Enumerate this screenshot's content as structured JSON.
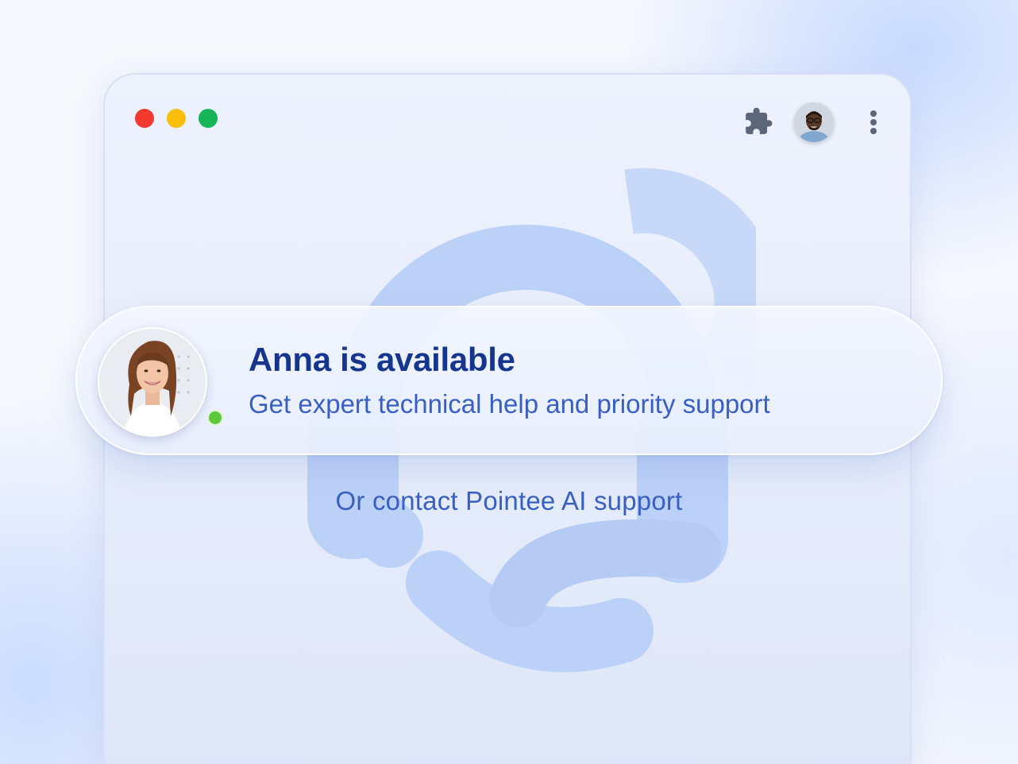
{
  "window": {
    "controls": [
      "close",
      "minimize",
      "maximize"
    ],
    "toolbar": {
      "extension_icon": "puzzle-icon",
      "profile_icon": "user-avatar",
      "menu_icon": "kebab-menu-icon"
    },
    "background_icon": "headset-icon"
  },
  "agent_card": {
    "title": "Anna is available",
    "subtitle": "Get expert technical help and priority support",
    "status": "online",
    "status_color": "#5cc93a"
  },
  "secondary_link": "Or contact Pointee AI support",
  "colors": {
    "primary_text": "#16358f",
    "secondary_text": "#3a5fc4",
    "traffic_red": "#f23a2e",
    "traffic_yellow": "#fbbf0a",
    "traffic_green": "#17b55a"
  }
}
